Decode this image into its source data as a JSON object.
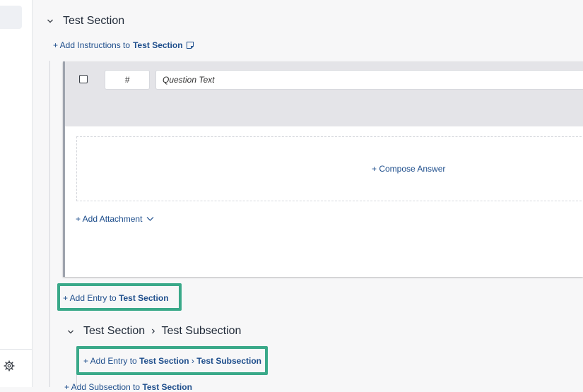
{
  "nav": {
    "settings_icon": "gear-icon"
  },
  "section": {
    "title": "Test Section",
    "instructions_prefix": "+ Add Instructions to",
    "instructions_target": "Test Section",
    "instructions_icon": "note-icon"
  },
  "entry": {
    "number_placeholder": "#",
    "question_placeholder": "Question Text",
    "compose_answer": "+ Compose Answer",
    "add_attachment": "+ Add Attachment"
  },
  "add_entry": {
    "prefix": "+ Add Entry to",
    "target": "Test Section"
  },
  "subsection": {
    "parent": "Test Section",
    "separator": "›",
    "title": "Test Subsection",
    "add_entry_prefix": "+ Add Entry to",
    "add_entry_parent": "Test Section",
    "add_entry_target": "Test Subsection"
  },
  "add_subsection": {
    "prefix": "+ Add Subsection to",
    "target": "Test Section"
  },
  "colors": {
    "link": "#1e4e8c",
    "highlight": "#3aa989",
    "card_header": "#e4e4e8"
  }
}
